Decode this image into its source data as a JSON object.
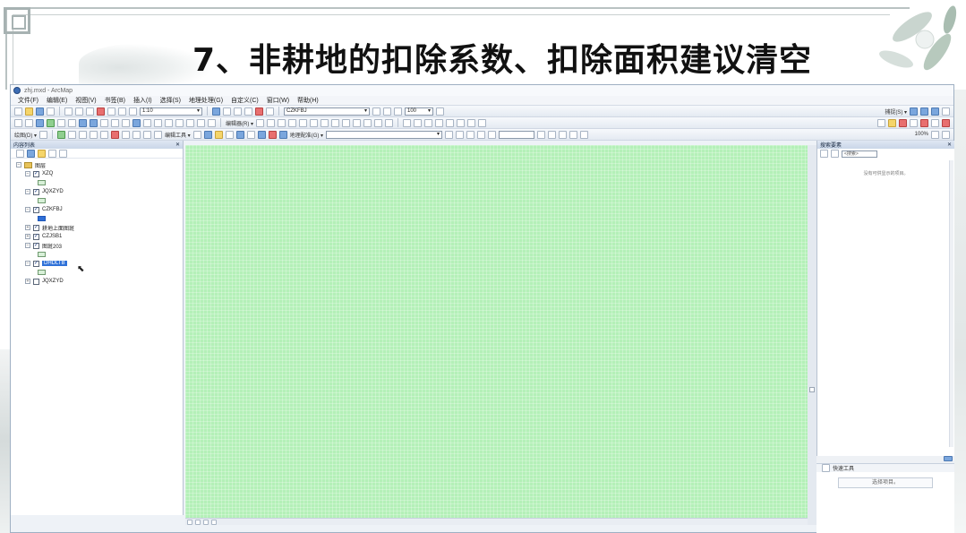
{
  "slide": {
    "title": "7、非耕地的扣除系数、扣除面积建议清空"
  },
  "window": {
    "title": "zhj.mxd - ArcMap"
  },
  "menu": [
    "文件(F)",
    "编辑(E)",
    "视图(V)",
    "书签(B)",
    "插入(I)",
    "选择(S)",
    "地理处理(G)",
    "自定义(C)",
    "窗口(W)",
    "帮助(H)"
  ],
  "toolbar": {
    "scale": "1:10",
    "layer_select": "CZKFBJ",
    "zoom_value": "100",
    "edit_label": "编辑器(R) ▾",
    "georef_label": "地理配准(G) ▾",
    "draw_label": "绘图(D) ▾",
    "draw_font_size": "10",
    "edit_tools_label": "编辑工具 ▾",
    "catalog_label": "表格(S) ▾",
    "snap_label": "捕捉(S) ▾",
    "percent": "100%"
  },
  "toc": {
    "header": "内容列表",
    "close": "✕",
    "root_label": "图层",
    "layers": [
      {
        "name": "XZQ",
        "checked": true,
        "symbol": "green"
      },
      {
        "name": "JQXZYD",
        "checked": true,
        "symbol": "green"
      },
      {
        "name": "CZKFBJ",
        "checked": true,
        "symbol": "blue"
      },
      {
        "name": "耕地上面图斑",
        "checked": true,
        "symbol": ""
      },
      {
        "name": "CZJSB1",
        "checked": true,
        "symbol": ""
      },
      {
        "name": "图斑203",
        "checked": true,
        "symbol": "green"
      },
      {
        "name": "DHDLTB",
        "checked": true,
        "symbol": "green",
        "selected": true
      },
      {
        "name": "JQXZYD",
        "checked": false,
        "symbol": ""
      }
    ]
  },
  "search": {
    "header": "搜索要素",
    "combo": "<搜索>",
    "hint": "没有可供显示的项目。"
  },
  "catalog": {
    "header": "快速工具",
    "button": "选择项目。"
  },
  "colors": {
    "map_fill": "#b4f0b8",
    "selection": "#2f71d8",
    "panel_header": "#c9d6e8"
  }
}
